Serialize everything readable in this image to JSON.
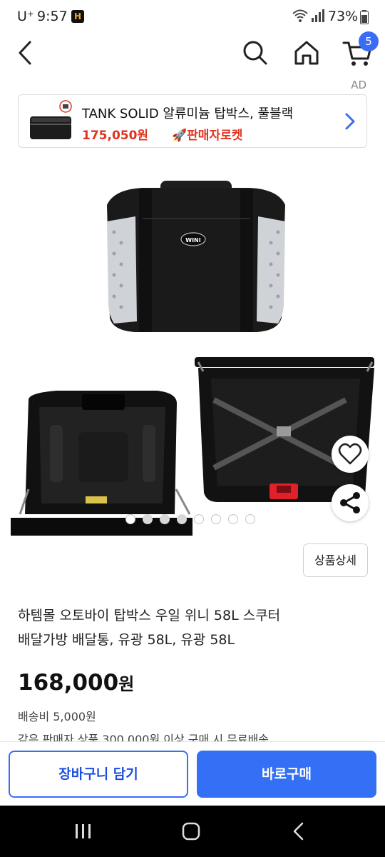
{
  "status_bar": {
    "carrier": "U⁺",
    "time": "9:57",
    "app_badge": "H",
    "battery": "73%"
  },
  "header": {
    "cart_count": "5"
  },
  "ad": {
    "label": "AD",
    "title": "TANK SOLID 알류미늄 탑박스, 풀블랙",
    "price": "175,050원",
    "rocket_label": "🚀판매자로켓"
  },
  "gallery": {
    "image_count": 8,
    "active_index": 1
  },
  "product": {
    "detail_button": "상품상세",
    "title_line1": "하템몰 오토바이 탑박스 우일 위니 58L 스쿠터",
    "title_line2": "배달가방 배달통, 유광 58L, 유광 58L",
    "price": "168,000",
    "price_unit": "원",
    "shipping": "배송비 5,000원",
    "free_shipping_note": "같은 판매자 상품 300,000원 이상 구매 시 무료배송",
    "logo_text": "WINI"
  },
  "actions": {
    "add_to_cart": "장바구니 담기",
    "buy_now": "바로구매"
  },
  "colors": {
    "accent": "#3370f5",
    "sale_red": "#e0341f"
  },
  "icons": [
    "back-arrow-icon",
    "search-icon",
    "home-icon",
    "cart-icon",
    "heart-icon",
    "share-icon",
    "chevron-right-icon"
  ]
}
